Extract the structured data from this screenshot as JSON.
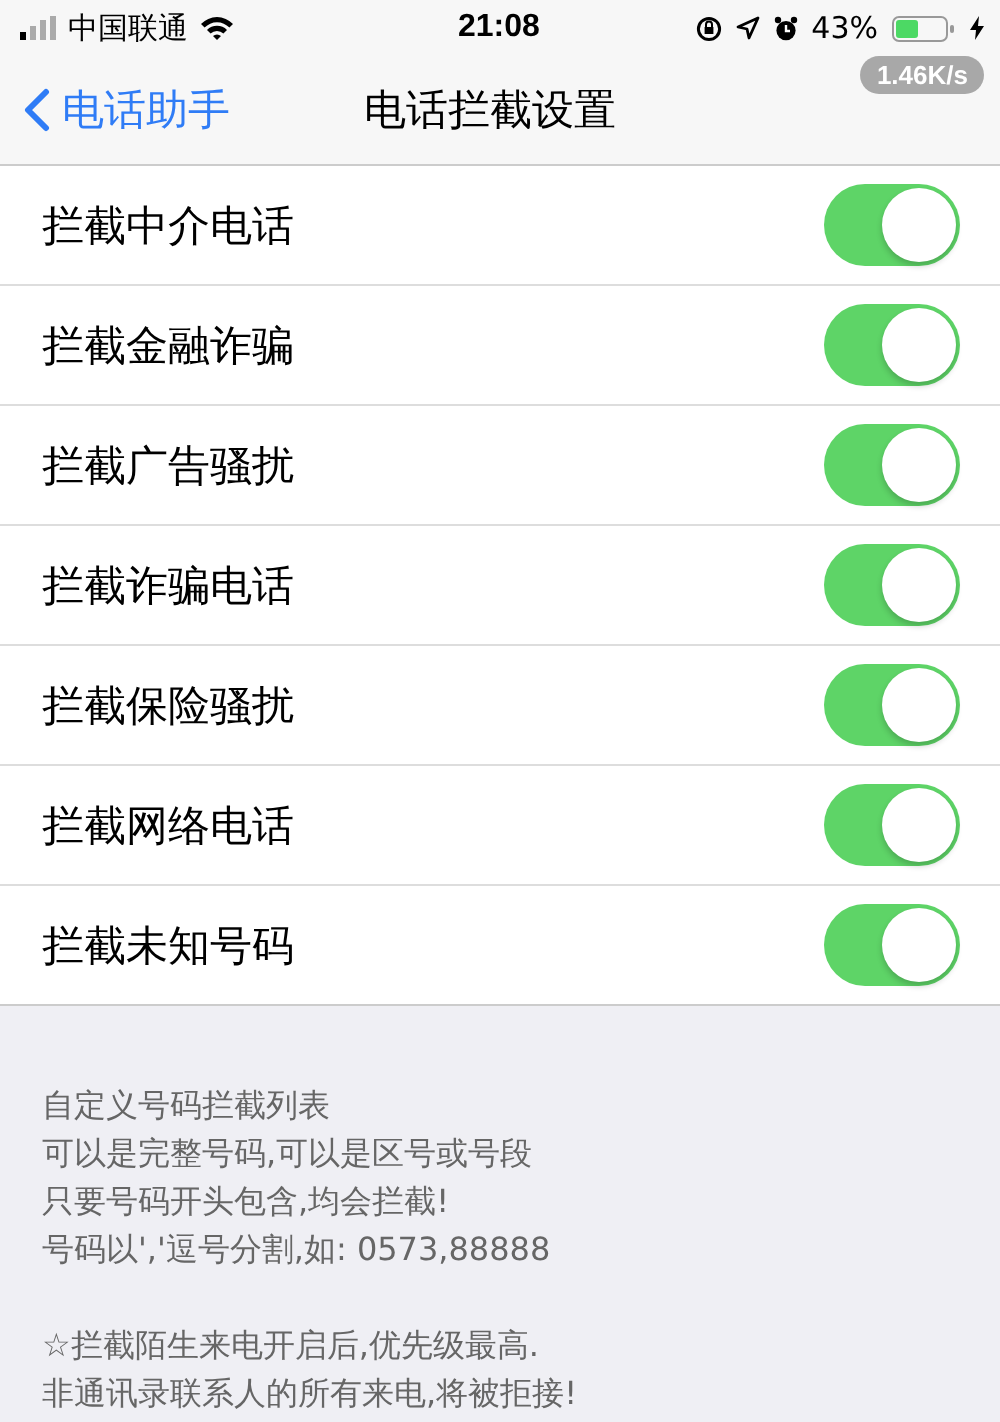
{
  "status_bar": {
    "carrier": "中国联通",
    "time": "21:08",
    "battery": "43%",
    "speed": "1.46K/s"
  },
  "nav": {
    "back": "电话助手",
    "title": "电话拦截设置"
  },
  "settings": [
    {
      "label": "拦截中介电话",
      "on": true
    },
    {
      "label": "拦截金融诈骗",
      "on": true
    },
    {
      "label": "拦截广告骚扰",
      "on": true
    },
    {
      "label": "拦截诈骗电话",
      "on": true
    },
    {
      "label": "拦截保险骚扰",
      "on": true
    },
    {
      "label": "拦截网络电话",
      "on": true
    },
    {
      "label": "拦截未知号码",
      "on": true
    }
  ],
  "notes": [
    [
      "自定义号码拦截列表",
      "可以是完整号码,可以是区号或号段",
      "只要号码开头包含,均会拦截!",
      "号码以','逗号分割,如: 0573,88888"
    ],
    [
      "☆拦截陌生来电开启后,优先级最高.",
      "非通讯录联系人的所有来电,将被拒接!"
    ]
  ]
}
